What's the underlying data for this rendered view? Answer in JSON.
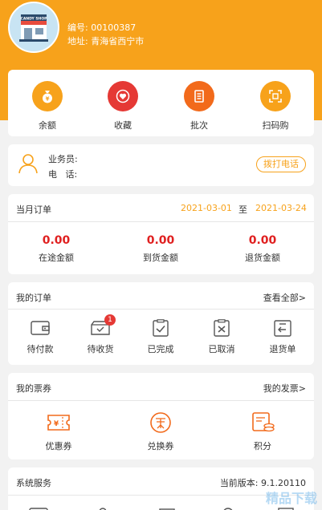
{
  "header": {
    "code_label": "编号: 00100387",
    "address_label": "地址: 青海省西宁市",
    "avatar_sign": "CANDY SHOP"
  },
  "quick": [
    {
      "label": "余额",
      "icon": "money-bag-icon",
      "color": "#f7a21b"
    },
    {
      "label": "收藏",
      "icon": "heart-icon",
      "color": "#e53935"
    },
    {
      "label": "批次",
      "icon": "document-icon",
      "color": "#f26a1b"
    },
    {
      "label": "扫码购",
      "icon": "scan-icon",
      "color": "#f7a21b"
    }
  ],
  "salesman": {
    "salesman_label": "业务员:",
    "phone_label": "电   话:",
    "call_button": "拨打电话"
  },
  "monthly": {
    "title": "当月订单",
    "start_date": "2021-03-01",
    "to": "至",
    "end_date": "2021-03-24",
    "amounts": [
      {
        "value": "0.00",
        "label": "在途金额"
      },
      {
        "value": "0.00",
        "label": "到货金额"
      },
      {
        "value": "0.00",
        "label": "退货金额"
      }
    ]
  },
  "orders": {
    "title": "我的订单",
    "view_all": "查看全部>",
    "items": [
      {
        "label": "待付款",
        "icon": "wallet-icon"
      },
      {
        "label": "待收货",
        "icon": "delivery-box-icon",
        "badge": "1"
      },
      {
        "label": "已完成",
        "icon": "clipboard-check-icon"
      },
      {
        "label": "已取消",
        "icon": "clipboard-x-icon"
      },
      {
        "label": "退货单",
        "icon": "return-icon"
      }
    ]
  },
  "tickets": {
    "title": "我的票券",
    "invoice_link": "我的发票>",
    "items": [
      {
        "label": "优惠券",
        "icon": "coupon-icon"
      },
      {
        "label": "兑换券",
        "icon": "exchange-icon"
      },
      {
        "label": "积分",
        "icon": "points-icon"
      }
    ]
  },
  "system": {
    "title": "系统服务",
    "version": "当前版本: 9.1.20110"
  },
  "watermark": "精品下载",
  "colors": {
    "accent": "#f7a21b",
    "price_red": "#e02020",
    "header_bg": "#f7a21b"
  }
}
